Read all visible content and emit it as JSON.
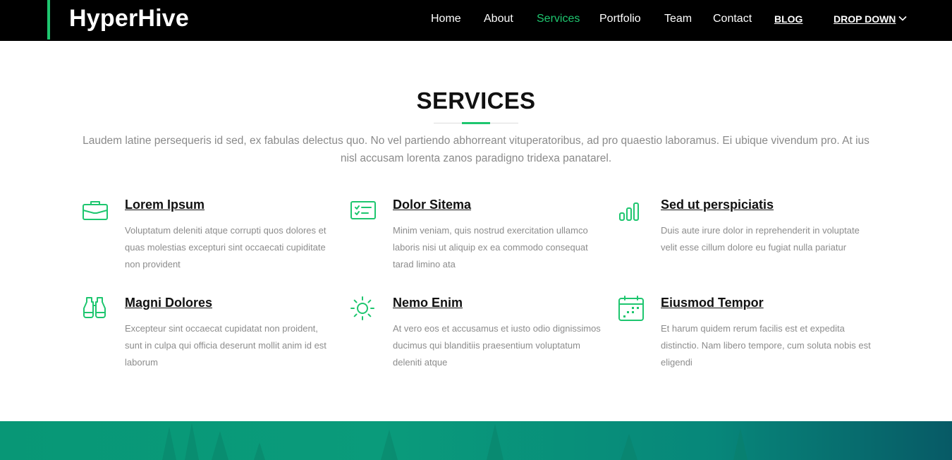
{
  "brand": {
    "name": "HyperHive",
    "accent": "#1ec66f"
  },
  "nav": {
    "items": [
      {
        "label": "Home",
        "active": false
      },
      {
        "label": "About",
        "active": false
      },
      {
        "label": "Services",
        "active": true
      },
      {
        "label": "Portfolio",
        "active": false
      },
      {
        "label": "Team",
        "active": false
      },
      {
        "label": "Contact",
        "active": false
      },
      {
        "label": "BLOG",
        "active": false
      },
      {
        "label": "DROP DOWN",
        "active": false,
        "icon": "chevron-down-icon"
      }
    ]
  },
  "section": {
    "title": "SERVICES",
    "intro": "Laudem latine persequeris id sed, ex fabulas delectus quo. No vel partiendo abhorreant vituperatoribus, ad pro quaestio laboramus. Ei ubique vivendum pro. At ius nisl accusam lorenta zanos paradigno tridexa panatarel."
  },
  "services": [
    {
      "icon": "briefcase-icon",
      "title": "Lorem Ipsum",
      "description": "Voluptatum deleniti atque corrupti quos dolores et quas molestias excepturi sint occaecati cupiditate non provident"
    },
    {
      "icon": "card-checklist-icon",
      "title": "Dolor Sitema",
      "description": "Minim veniam, quis nostrud exercitation ullamco laboris nisi ut aliquip ex ea commodo consequat tarad limino ata"
    },
    {
      "icon": "bar-chart-icon",
      "title": "Sed ut perspiciatis",
      "description": "Duis aute irure dolor in reprehenderit in voluptate velit esse cillum dolore eu fugiat nulla pariatur"
    },
    {
      "icon": "binoculars-icon",
      "title": "Magni Dolores",
      "description": "Excepteur sint occaecat cupidatat non proident, sunt in culpa qui officia deserunt mollit anim id est laborum"
    },
    {
      "icon": "sun-icon",
      "title": "Nemo Enim",
      "description": "At vero eos et accusamus et iusto odio dignissimos ducimus qui blanditiis praesentium voluptatum deleniti atque"
    },
    {
      "icon": "calendar-icon",
      "title": "Eiusmod Tempor",
      "description": "Et harum quidem rerum facilis est et expedita distinctio. Nam libero tempore, cum soluta nobis est eligendi"
    }
  ]
}
